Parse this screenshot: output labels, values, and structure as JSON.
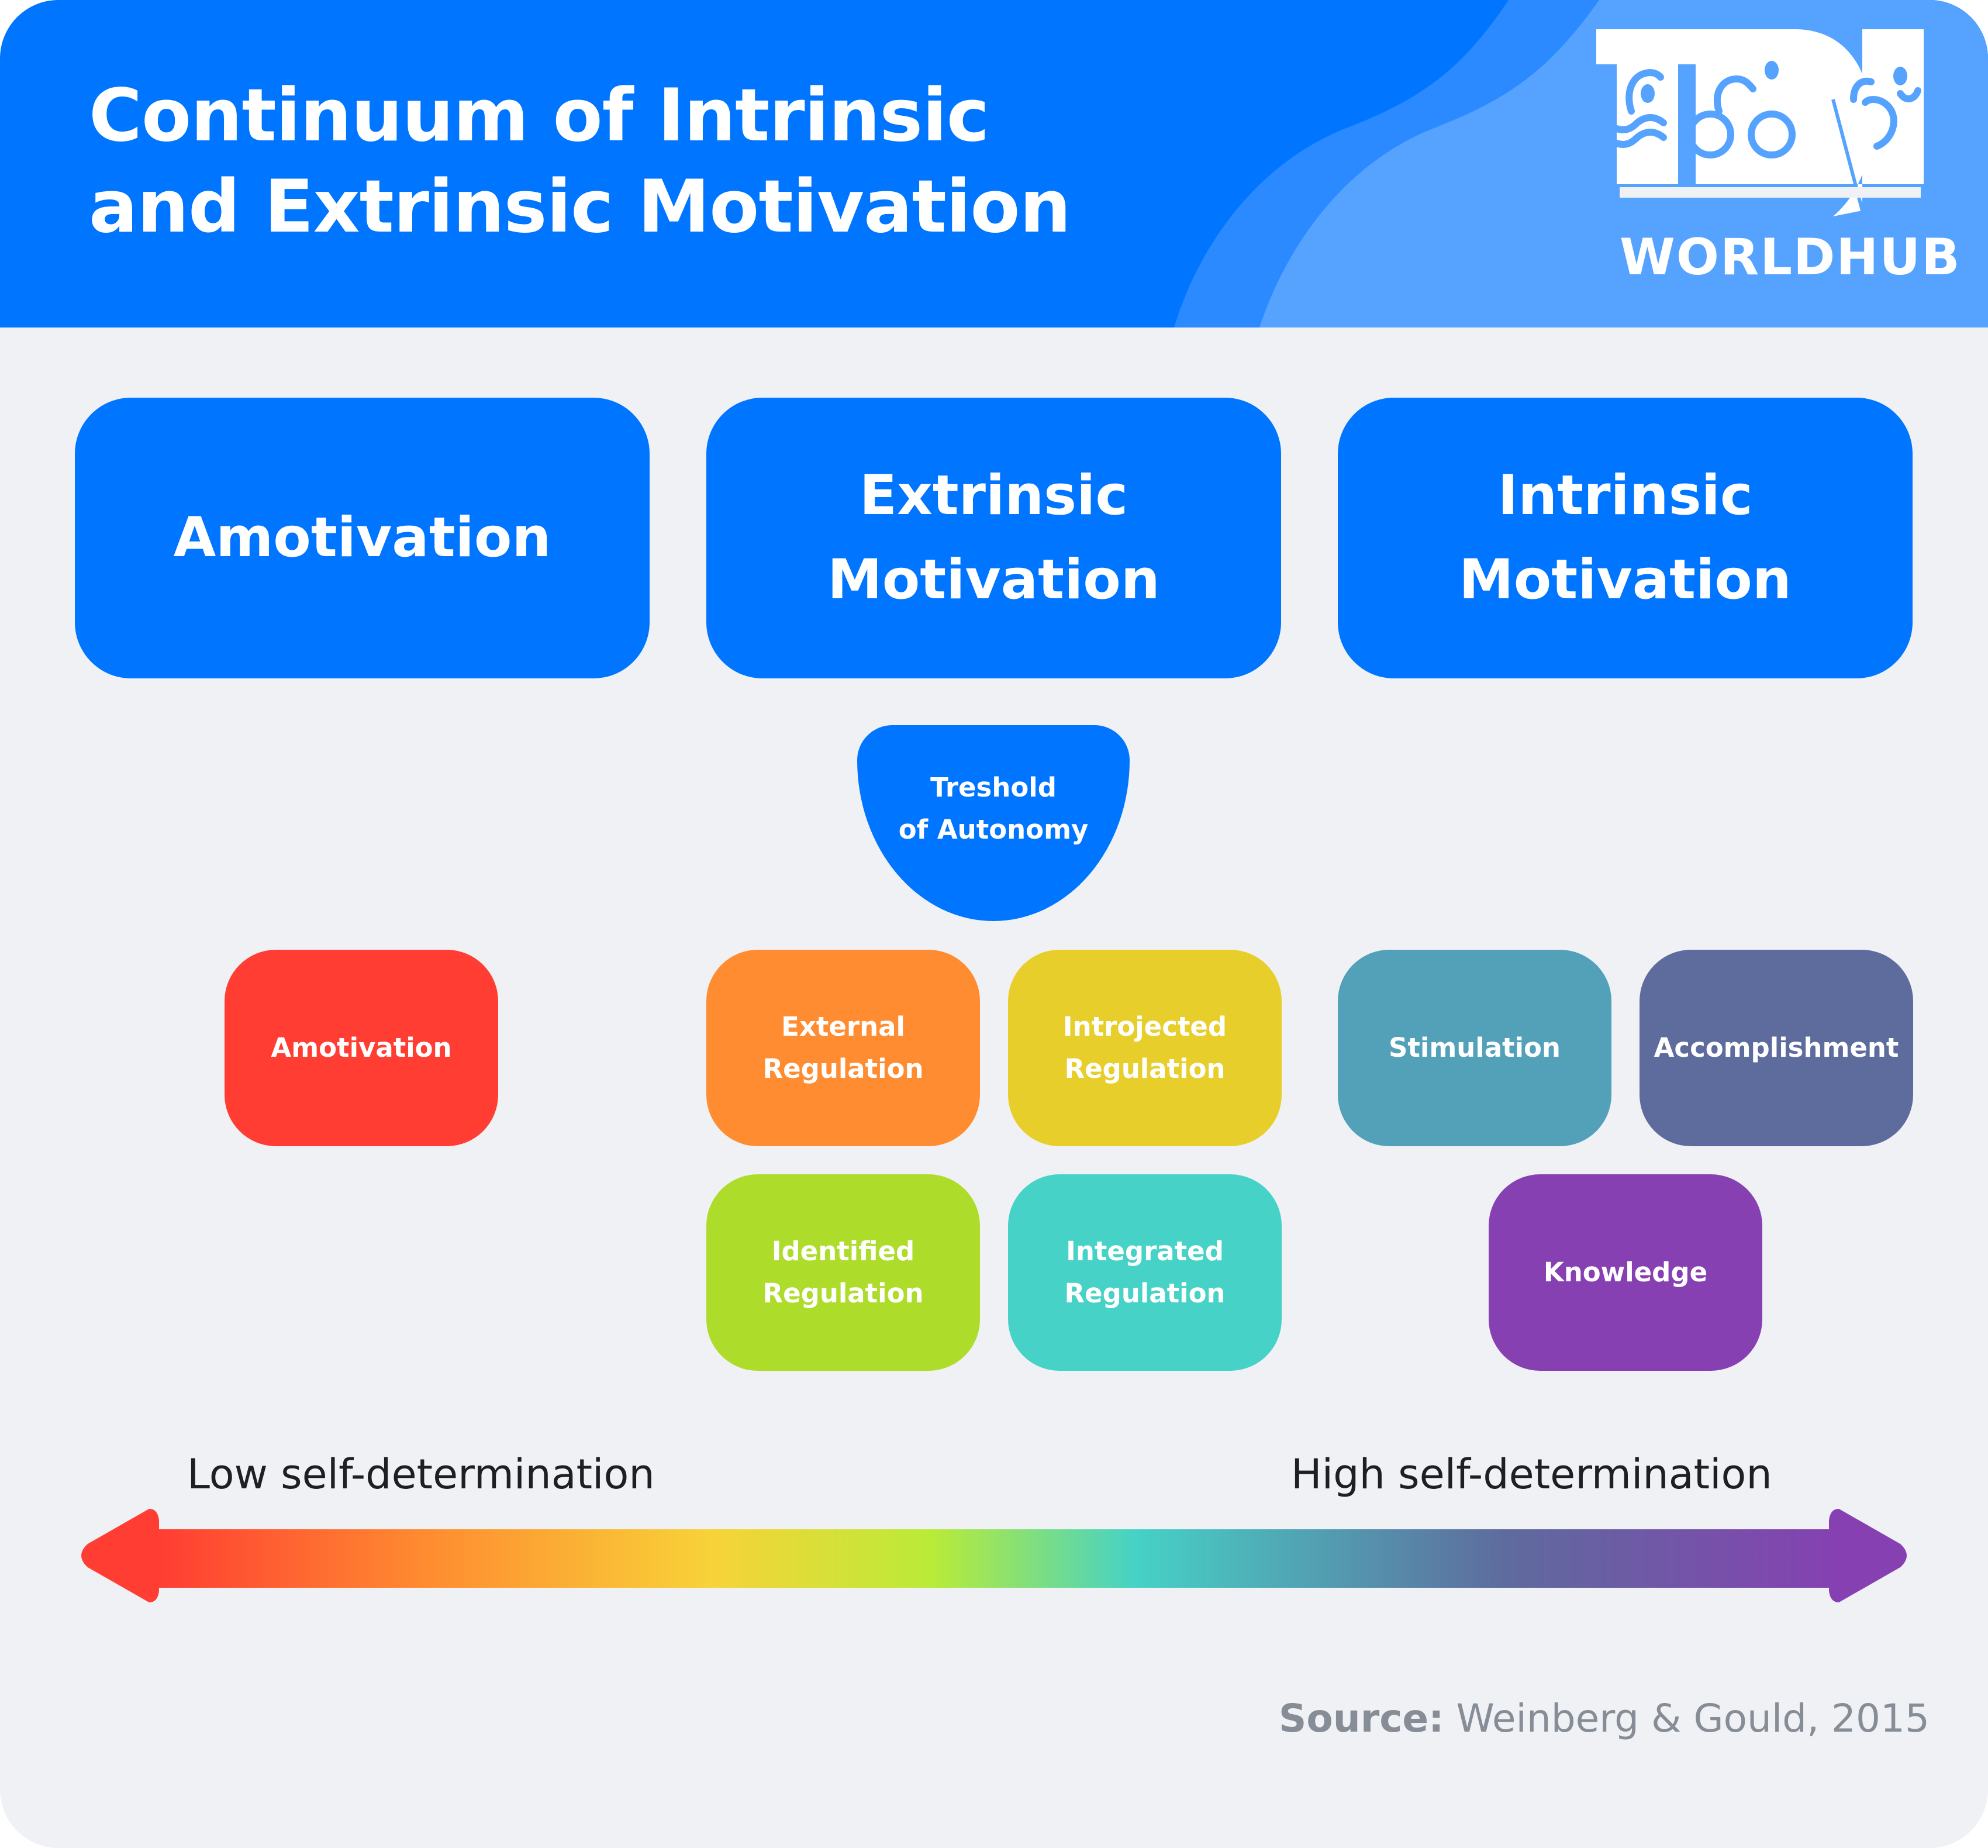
{
  "header": {
    "title_line1": "Continuum of Intrinsic",
    "title_line2": "and Extrinsic Motivation",
    "logo_text": "WORLDHUB",
    "logo_icon": "tri-swim-bike-run-logo",
    "colors": {
      "primary": "#0075FF",
      "wave_mid": "#2B8AFF",
      "wave_light": "#55A3FF"
    }
  },
  "categories": [
    {
      "line1": "Amotivation",
      "line2": ""
    },
    {
      "line1": "Extrinsic",
      "line2": "Motivation"
    },
    {
      "line1": "Intrinsic",
      "line2": "Motivation"
    }
  ],
  "threshold": {
    "line1": "Treshold",
    "line2": "of Autonomy"
  },
  "regulations": [
    {
      "line1": "Amotivation",
      "line2": "",
      "color": "#FF3D33"
    },
    {
      "line1": "External",
      "line2": "Regulation",
      "color": "#FF8C30"
    },
    {
      "line1": "Introjected",
      "line2": "Regulation",
      "color": "#E8CE2A"
    },
    {
      "line1": "Identified",
      "line2": "Regulation",
      "color": "#AEDC2A"
    },
    {
      "line1": "Integrated",
      "line2": "Regulation",
      "color": "#46D2C6"
    },
    {
      "line1": "Stimulation",
      "line2": "",
      "color": "#52A1B9"
    },
    {
      "line1": "Accomplishment",
      "line2": "",
      "color": "#5E6B9D"
    },
    {
      "line1": "Knowledge",
      "line2": "",
      "color": "#8640B2"
    }
  ],
  "scale": {
    "low_label": "Low self-determination",
    "high_label": "High self-determination",
    "gradient": [
      "#FF3D33",
      "#FF8C30",
      "#F7D338",
      "#B9EB38",
      "#46D2C6",
      "#5E6B9D",
      "#8640B2"
    ]
  },
  "source": {
    "label": "Source:",
    "text": " Weinberg & Gould, 2015"
  }
}
